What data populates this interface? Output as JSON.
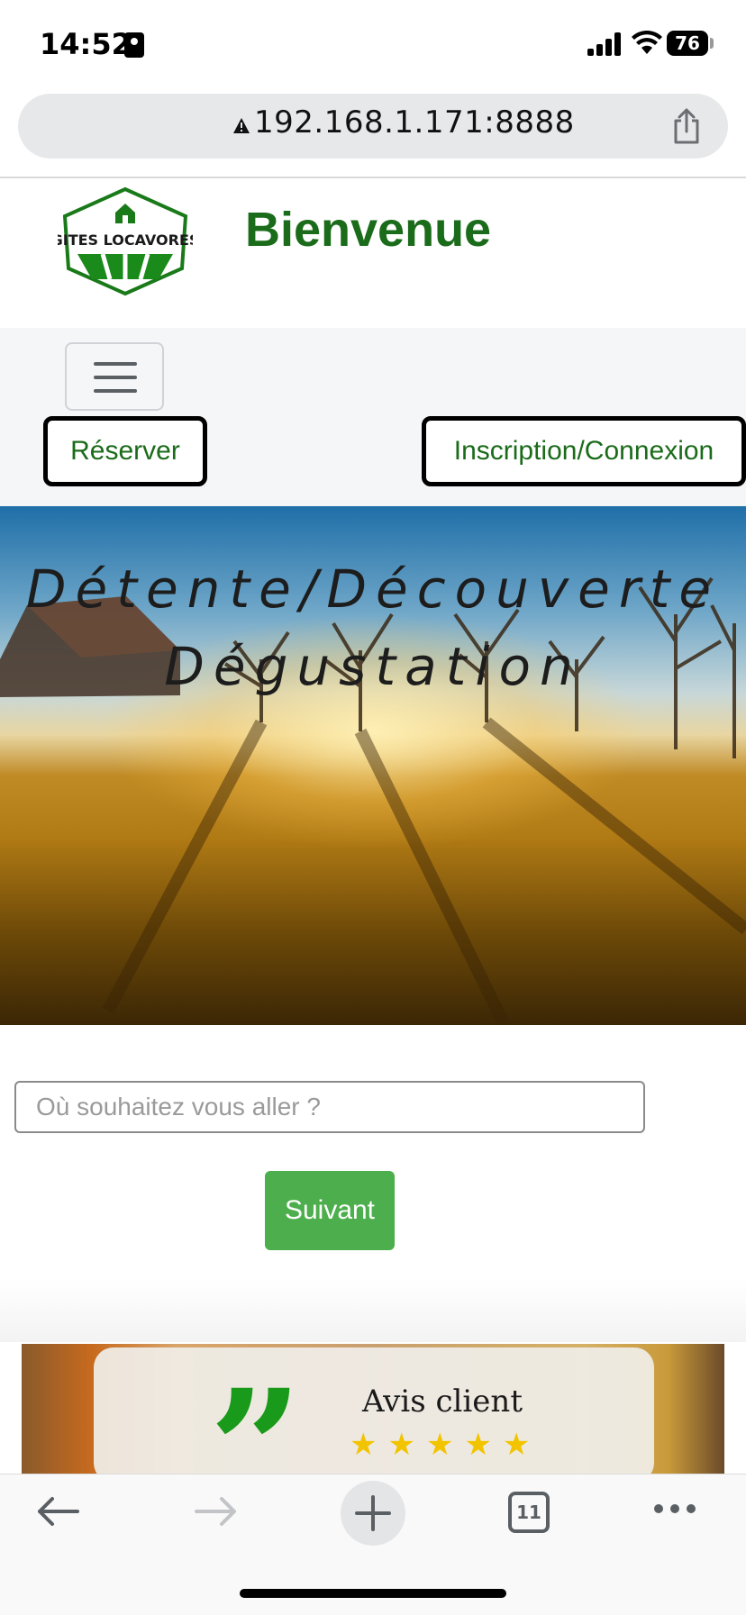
{
  "status_bar": {
    "time": "14:52",
    "battery": "76"
  },
  "address_bar": {
    "url": "192.168.1.171:8888",
    "warning_icon": "warning-triangle-icon",
    "share_icon": "share-icon"
  },
  "header": {
    "logo_text": "GITES LOCAVORES",
    "title": "Bienvenue"
  },
  "nav": {
    "menu_icon": "hamburger-icon",
    "reserve_label": "Réserver",
    "auth_label": "Inscription/Connexion"
  },
  "hero": {
    "line1": "Détente/Découverte",
    "line2": "Dégustation"
  },
  "search": {
    "placeholder": "Où souhaitez vous aller ?",
    "value": "",
    "submit_label": "Suivant"
  },
  "review": {
    "title": "Avis client",
    "rating": 5,
    "stars": "★★★★★"
  },
  "toolbar": {
    "tab_count": "11"
  },
  "colors": {
    "brand_green": "#1a6b1a",
    "button_green": "#4cae4c",
    "star_yellow": "#f2c400"
  }
}
